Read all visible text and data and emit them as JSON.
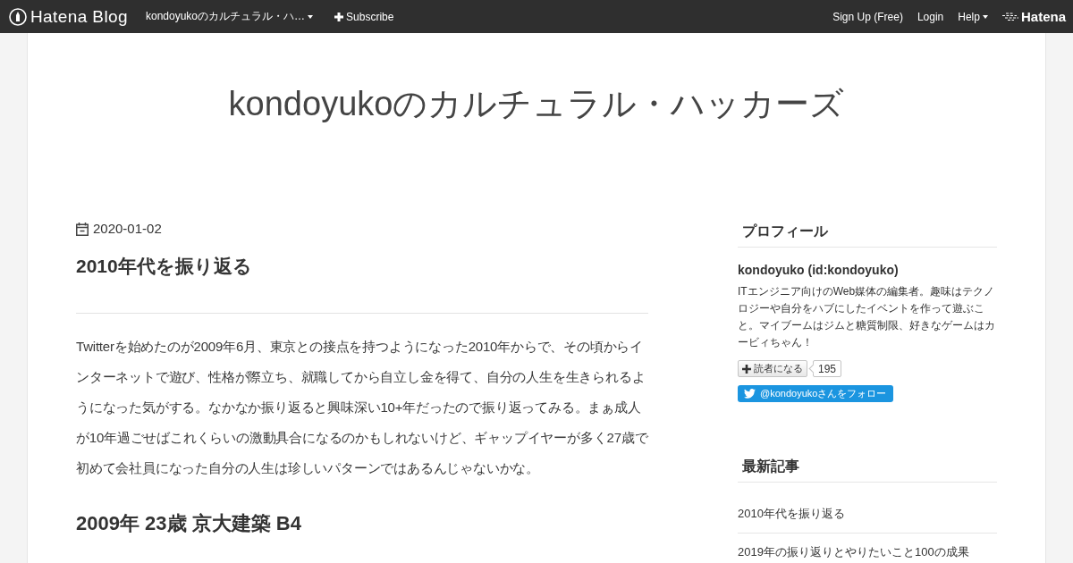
{
  "top_bar": {
    "logo": "Hatena Blog",
    "blog_menu": "kondoyukoのカルチュラル・ハ…",
    "subscribe": "Subscribe",
    "links": [
      "Sign Up (Free)",
      "Login"
    ],
    "help": "Help",
    "brand": "Hatena"
  },
  "blog_title": "kondoyukoのカルチュラル・ハッカーズ",
  "article": {
    "date": "2020-01-02",
    "title": "2010年代を振り返る",
    "body": "Twitterを始めたのが2009年6月、東京との接点を持つようになった2010年からで、その頃からインターネットで遊び、性格が際立ち、就職してから自立し金を得て、自分の人生を生きられるようになった気がする。なかなか振り返ると興味深い10+年だったので振り返ってみる。まぁ成人が10年過ごせばこれくらいの激動具合になるのかもしれないけど、ギャップイヤーが多く27歳で初めて会社員になった自分の人生は珍しいパターンではあるんじゃないかな。",
    "heading": "2009年 23歳 京大建築 B4"
  },
  "sidebar": {
    "profile": {
      "heading": "プロフィール",
      "name": "kondoyuko (id:kondoyuko)",
      "bio": "ITエンジニア向けのWeb媒体の編集者。趣味はテクノロジーや自分をハブにしたイベントを作って遊ぶこと。マイブームはジムと糖質制限、好きなゲームはカービィちゃん！",
      "reader_button": "読者になる",
      "reader_count": "195",
      "follow_button": "@kondoyukoさんをフォロー"
    },
    "recent": {
      "heading": "最新記事",
      "items": [
        "2010年代を振り返る",
        "2019年の振り返りとやりたいこと100の成果"
      ]
    }
  }
}
